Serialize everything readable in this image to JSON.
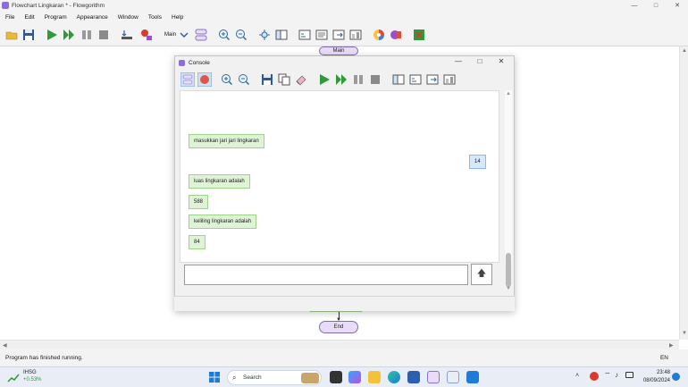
{
  "window": {
    "title": "Flowchart Lingkaran * - Flowgorithm",
    "controls": {
      "minimize": "—",
      "maximize": "□",
      "close": "✕"
    }
  },
  "menu": [
    "File",
    "Edit",
    "Program",
    "Appearance",
    "Window",
    "Tools",
    "Help"
  ],
  "toolbar": {
    "function_label": "Main"
  },
  "canvas": {
    "main_label": "Main",
    "end_label": "End"
  },
  "console": {
    "title": "Console",
    "controls": {
      "minimize": "—",
      "maximize": "□",
      "close": "✕"
    },
    "messages": [
      {
        "kind": "output",
        "text": "masukkan jari jari lingkaran"
      },
      {
        "kind": "input",
        "text": "14"
      },
      {
        "kind": "output",
        "text": "luas lingkaran adalah"
      },
      {
        "kind": "output",
        "text": "588"
      },
      {
        "kind": "output",
        "text": "keliling lingkaran adalah"
      },
      {
        "kind": "output",
        "text": "84"
      }
    ],
    "input_value": "",
    "send_icon": "arrow-up"
  },
  "status": {
    "text": "Program has finished running.",
    "language": "EN"
  },
  "taskbar": {
    "stock_name": "IHSG",
    "stock_change": "+0.53%",
    "search_placeholder": "Search",
    "time": "23:48",
    "date": "08/09/2024"
  }
}
